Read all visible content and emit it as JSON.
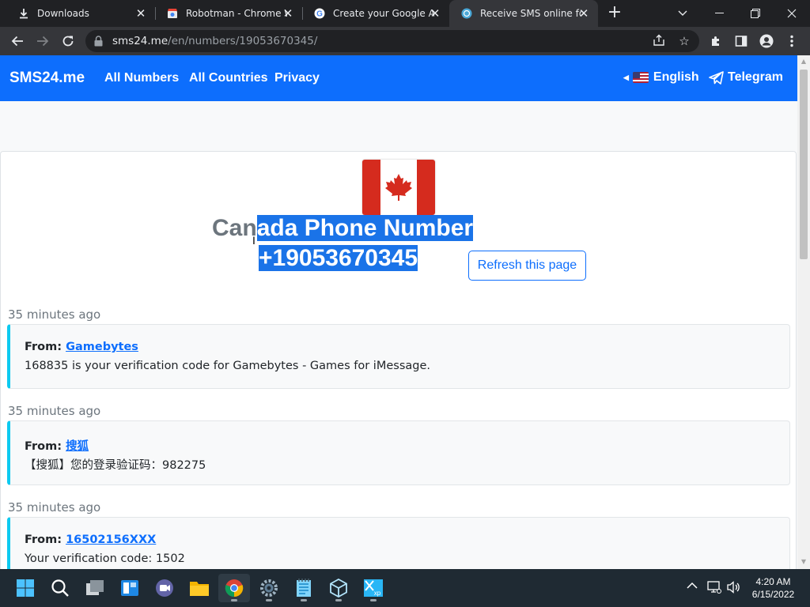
{
  "browser": {
    "tabs": [
      {
        "title": "Downloads",
        "icon": "download-icon",
        "active": false
      },
      {
        "title": "Robotman - Chrome W",
        "icon": "chrome-webstore-icon",
        "active": false
      },
      {
        "title": "Create your Google Ac",
        "icon": "google-g-icon",
        "active": false
      },
      {
        "title": "Receive SMS online for",
        "icon": "sms24-icon",
        "active": true
      }
    ],
    "url_host": "sms24.me",
    "url_path": "/en/numbers/19053670345/"
  },
  "site": {
    "brand": "SMS24.me",
    "nav": [
      "All Numbers",
      "All Countries",
      "Privacy"
    ],
    "language": "English",
    "telegram": "Telegram",
    "accent": "#0d6efd"
  },
  "number": {
    "heading_line1_plain": "Can",
    "heading_line1_selected": "ada Phone Number ",
    "heading_line2": "+19053670345",
    "refresh_label": "Refresh this page",
    "country_flag": "canada-flag"
  },
  "messages": [
    {
      "time": "35 minutes ago",
      "from_label": "From:",
      "sender": "Gamebytes",
      "body": "168835 is your verification code for Gamebytes - Games for iMessage."
    },
    {
      "time": "35 minutes ago",
      "from_label": "From:",
      "sender": "搜狐",
      "body": "【搜狐】您的登录验证码：982275"
    },
    {
      "time": "35 minutes ago",
      "from_label": "From:",
      "sender": "16502156XXX",
      "body": "Your verification code: 1502"
    }
  ],
  "taskbar": {
    "apps": [
      "start",
      "search",
      "task-view",
      "file-explorer-widgets",
      "teams-chat",
      "file-explorer",
      "chrome",
      "settings",
      "notepad",
      "virtualbox",
      "windows-xp-vm"
    ],
    "time": "4:20 AM",
    "date": "6/15/2022"
  }
}
